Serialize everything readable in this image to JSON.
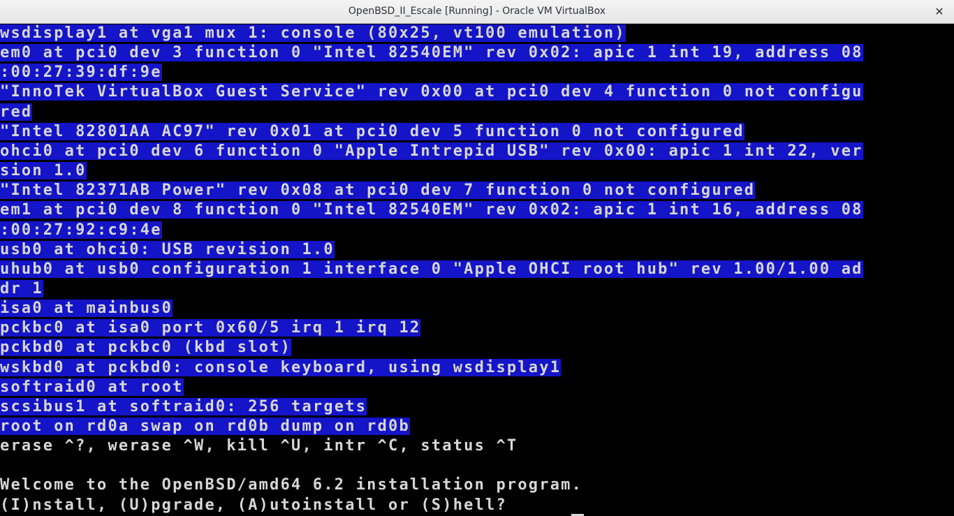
{
  "window": {
    "title": "OpenBSD_II_Escale [Running] - Oracle VM VirtualBox",
    "close_glyph": "✕"
  },
  "console": {
    "lines": [
      "wsdisplay1 at vga1 mux 1: console (80x25, vt100 emulation)",
      "em0 at pci0 dev 3 function 0 \"Intel 82540EM\" rev 0x02: apic 1 int 19, address 08",
      ":00:27:39:df:9e",
      "\"InnoTek VirtualBox Guest Service\" rev 0x00 at pci0 dev 4 function 0 not configu",
      "red",
      "\"Intel 82801AA AC97\" rev 0x01 at pci0 dev 5 function 0 not configured",
      "ohci0 at pci0 dev 6 function 0 \"Apple Intrepid USB\" rev 0x00: apic 1 int 22, ver",
      "sion 1.0",
      "\"Intel 82371AB Power\" rev 0x08 at pci0 dev 7 function 0 not configured",
      "em1 at pci0 dev 8 function 0 \"Intel 82540EM\" rev 0x02: apic 1 int 16, address 08",
      ":00:27:92:c9:4e",
      "usb0 at ohci0: USB revision 1.0",
      "uhub0 at usb0 configuration 1 interface 0 \"Apple OHCI root hub\" rev 1.00/1.00 ad",
      "dr 1",
      "isa0 at mainbus0",
      "pckbc0 at isa0 port 0x60/5 irq 1 irq 12",
      "pckbd0 at pckbc0 (kbd slot)",
      "wskbd0 at pckbd0: console keyboard, using wsdisplay1",
      "softraid0 at root",
      "scsibus1 at softraid0: 256 targets",
      "root on rd0a swap on rd0b dump on rd0b",
      "erase ^?, werase ^W, kill ^U, intr ^C, status ^T",
      "",
      "Welcome to the OpenBSD/amd64 6.2 installation program.",
      "(I)nstall, (U)pgrade, (A)utoinstall or (S)hell? "
    ],
    "selected_count": 21,
    "selection_color": "#1414c8",
    "text_color": "#d7d7d7",
    "background_color": "#000000"
  }
}
